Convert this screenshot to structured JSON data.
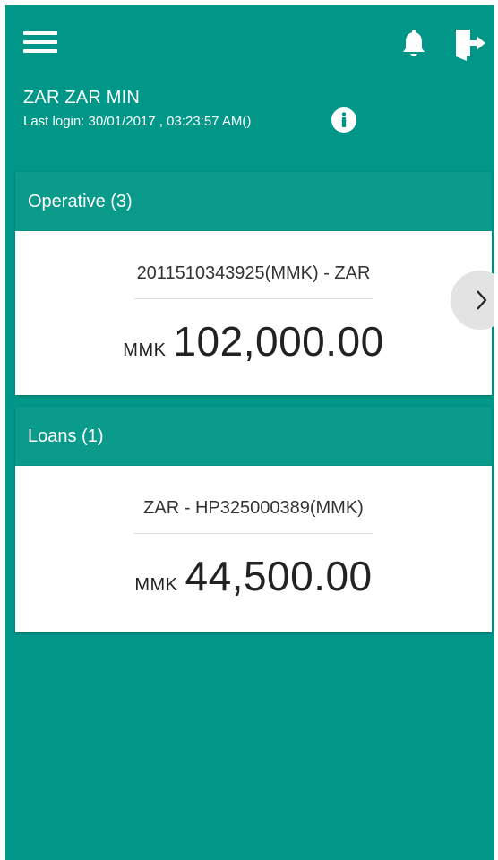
{
  "header": {
    "user_name": "ZAR ZAR MIN",
    "last_login": "Last login: 30/01/2017 , 03:23:57 AM()",
    "icons": {
      "menu": "hamburger-menu-icon",
      "notifications": "bell-icon",
      "logout": "logout-door-icon",
      "info": "info-icon"
    }
  },
  "sections": [
    {
      "title": "Operative (3)",
      "account": "2011510343925(MMK) - ZAR",
      "currency": "MMK",
      "amount": "102,000.00"
    },
    {
      "title": "Loans (1)",
      "account": "ZAR - HP325000389(MMK)",
      "currency": "MMK",
      "amount": "44,500.00"
    }
  ],
  "colors": {
    "background": "#009688",
    "card_header": "#0b9b8b",
    "card_body": "#ffffff"
  }
}
